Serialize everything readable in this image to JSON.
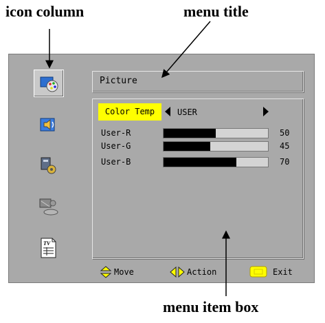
{
  "callouts": {
    "icon_column": "icon column",
    "menu_title": "menu title",
    "menu_item_box": "menu item box"
  },
  "icons": [
    {
      "name": "picture-icon",
      "selected": true
    },
    {
      "name": "sound-icon",
      "selected": false
    },
    {
      "name": "setup-icon",
      "selected": false
    },
    {
      "name": "features-icon",
      "selected": false
    },
    {
      "name": "tv-guide-icon",
      "selected": false
    }
  ],
  "menu": {
    "title": "Picture",
    "selected_item": {
      "label": "Color Temp",
      "value": "USER"
    },
    "rows": [
      {
        "label": "User-R",
        "value": "50",
        "level": 0.5
      },
      {
        "label": "User-G",
        "value": "45",
        "level": 0.45
      },
      {
        "label": "User-B",
        "value": "70",
        "level": 0.7
      }
    ]
  },
  "footer": {
    "move": "Move",
    "action": "Action",
    "exit": "Exit"
  },
  "colors": {
    "screen_bg": "#a9a9a9",
    "highlight": "#ffff00",
    "bar_fill": "#000000",
    "bar_track": "#d4d4d4"
  }
}
